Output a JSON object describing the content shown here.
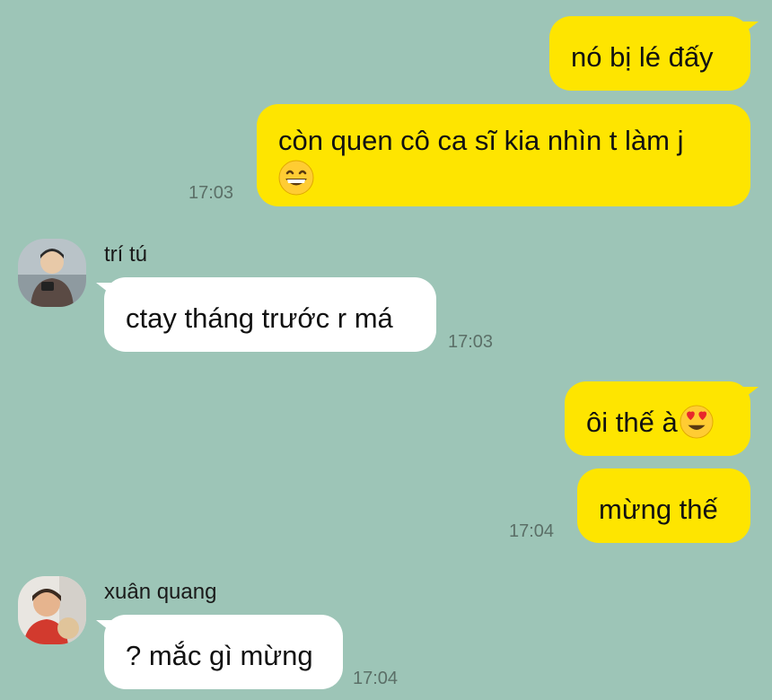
{
  "messages": [
    {
      "text": "nó bị lé đấy"
    },
    {
      "text": "còn quen cô ca sĩ kia nhìn t làm j",
      "emoji": "grinning-face-icon",
      "time": "17:03"
    },
    {
      "sender": "trí tú",
      "text": "ctay tháng trước r má",
      "time": "17:03"
    },
    {
      "text": "ôi thế à",
      "emoji": "heart-eyes-icon"
    },
    {
      "text": "mừng thế",
      "time": "17:04"
    },
    {
      "sender": "xuân quang",
      "text": "? mắc gì mừng",
      "time": "17:04"
    }
  ],
  "colors": {
    "background": "#9dc5b7",
    "outgoing_bubble": "#fee500",
    "incoming_bubble": "#ffffff",
    "timestamp": "#5b6f67"
  }
}
